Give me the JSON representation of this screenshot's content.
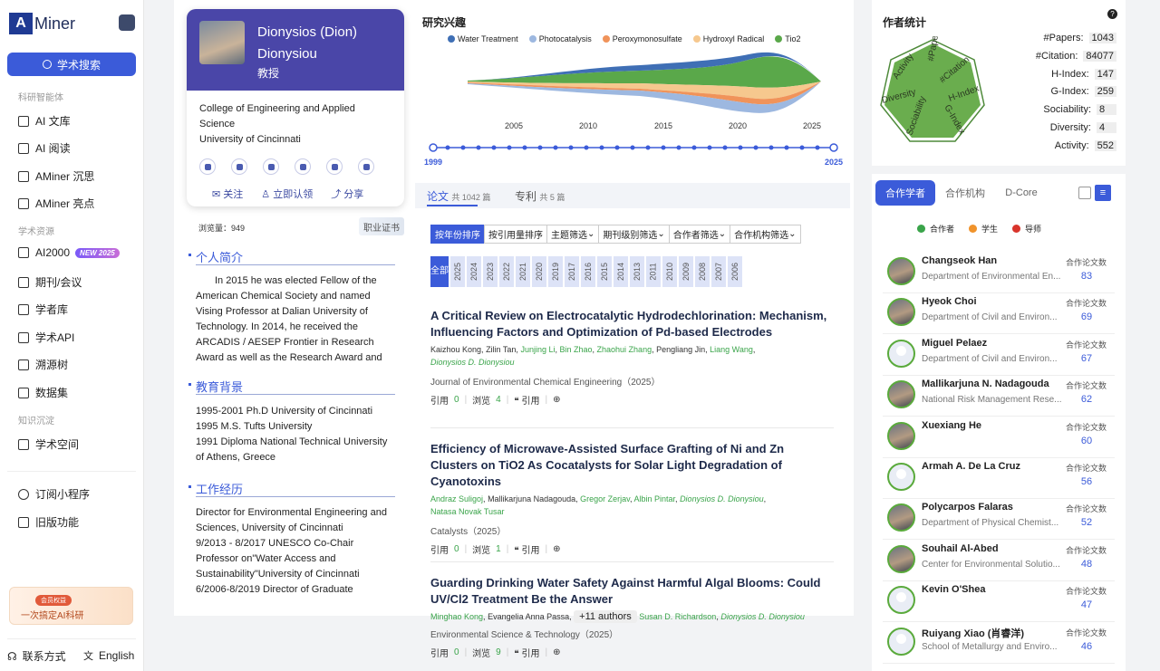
{
  "sidebar": {
    "logo_mark": "A",
    "logo_text": "Miner",
    "search_label": "学术搜索",
    "section1": "科研智能体",
    "items1": [
      "AI 文库",
      "AI 阅读",
      "AMiner 沉思",
      "AMiner 亮点"
    ],
    "section2": "学术资源",
    "items2": [
      "AI2000",
      "期刊/会议",
      "学者库",
      "学术API",
      "溯源树",
      "数据集"
    ],
    "new_badge": "NEW 2025",
    "section3": "知识沉淀",
    "items3": [
      "学术空间"
    ],
    "items4": [
      "订阅小程序",
      "旧版功能"
    ],
    "promo_tag": "会员权益",
    "promo_text": "一次搞定AI科研",
    "contact": "联系方式",
    "language": "English"
  },
  "profile": {
    "name_line1": "Dionysios (Dion)",
    "name_line2": "Dionysiou",
    "title": "教授",
    "affiliation": "College of Engineering and Applied Science",
    "university": "University of Cincinnati",
    "follow": "关注",
    "claim": "立即认领",
    "share": "分享",
    "views": "浏览量：949",
    "cert": "职业证书",
    "bio_heading": "个人简介",
    "bio": "In 2015 he was elected Fellow of the American Chemical Society and named Vising Professor at Dalian University of Technology. In 2014, he received the ARCADIS / AESEP Frontier in Research Award as well as the Research Award and",
    "edu_heading": "教育背景",
    "edu": [
      "1995-2001 Ph.D University of Cincinnati",
      "1995 M.S. Tufts University",
      "1991 Diploma National Technical University of Athens, Greece"
    ],
    "work_heading": "工作经历",
    "work": [
      "Director for Environmental Engineering and Sciences, University of Cincinnati",
      "9/2013 - 8/2017 UNESCO Co-Chair Professor on\"Water Access and Sustainability\"University of Cincinnati",
      "6/2006-8/2019 Director of Graduate"
    ]
  },
  "interests": {
    "heading": "研究兴趣",
    "topics": [
      {
        "name": "Water Treatment",
        "color": "#3f6fb5"
      },
      {
        "name": "Photocatalysis",
        "color": "#9db8e0"
      },
      {
        "name": "Peroxymonosulfate",
        "color": "#f0935a"
      },
      {
        "name": "Hydroxyl Radical",
        "color": "#f6c88e"
      },
      {
        "name": "Tio2",
        "color": "#5aa84a"
      }
    ],
    "axis_years": [
      "2005",
      "2010",
      "2015",
      "2020",
      "2025"
    ],
    "range_start": "1999",
    "range_end": "2025"
  },
  "papers_tabs": {
    "papers_label": "论文",
    "papers_count": "共 1042 篇",
    "patents_label": "专利",
    "patents_count": "共 5 篇"
  },
  "filters": [
    "按年份排序",
    "按引用量排序",
    "主题筛选",
    "期刊级别筛选",
    "合作者筛选",
    "合作机构筛选"
  ],
  "years": {
    "all": "全部",
    "list": [
      "2025",
      "2024",
      "2023",
      "2022",
      "2021",
      "2020",
      "2019",
      "2017",
      "2016",
      "2015",
      "2014",
      "2013",
      "2011",
      "2010",
      "2009",
      "2008",
      "2007",
      "2006"
    ]
  },
  "papers": [
    {
      "title": "A Critical Review on Electrocatalytic Hydrodechlorination: Mechanism, Influencing Factors and Optimization of Pd-based Electrodes",
      "venue": "Journal of Environmental Chemical Engineering（2025）",
      "cite_label": "引用",
      "cite": "0",
      "view_label": "浏览",
      "views": "4",
      "quote": "引用"
    },
    {
      "title": "Efficiency of Microwave-Assisted Surface Grafting of Ni and Zn Clusters on TiO2 As Cocatalysts for Solar Light Degradation of Cyanotoxins",
      "venue": "Catalysts（2025）",
      "cite_label": "引用",
      "cite": "0",
      "view_label": "浏览",
      "views": "1",
      "quote": "引用"
    },
    {
      "title": "Guarding Drinking Water Safety Against Harmful Algal Blooms: Could UV/Cl2 Treatment Be the Answer",
      "venue": "Environmental Science & Technology（2025）",
      "cite_label": "引用",
      "cite": "0",
      "view_label": "浏览",
      "views": "9",
      "quote": "引用",
      "more": "+11 authors"
    }
  ],
  "paper_authors": [
    [
      "Kaizhou Kong",
      "Zilin Tan",
      "Junjing Li",
      "Bin Zhao",
      "Zhaohui Zhang",
      "Pengliang Jin",
      "Liang Wang",
      "Dionysios D. Dionysiou"
    ],
    [
      "Andraz Suligoj",
      "Mallikarjuna Nadagouda",
      "Gregor Zerjav",
      "Albin Pintar",
      "Dionysios D. Dionysiou",
      "Natasa Novak Tusar"
    ],
    [
      "Minghao Kong",
      "Evangelia Anna Passa",
      "Susan D. Richardson",
      "Dionysios D. Dionysiou"
    ]
  ],
  "stats": {
    "heading": "作者统计",
    "help": "?",
    "radar_labels": [
      "#Papers",
      "#Citation",
      "H-Index",
      "G-Index",
      "Sociability",
      "Diversity",
      "Activity"
    ],
    "rows": [
      {
        "label": "#Papers:",
        "value": "1043"
      },
      {
        "label": "#Citation:",
        "value": "84077"
      },
      {
        "label": "H-Index:",
        "value": "147"
      },
      {
        "label": "G-Index:",
        "value": "259"
      },
      {
        "label": "Sociability:",
        "value": "8"
      },
      {
        "label": "Diversity:",
        "value": "4"
      },
      {
        "label": "Activity:",
        "value": "552"
      }
    ]
  },
  "coauthors": {
    "tabs": [
      "合作学者",
      "合作机构",
      "D-Core"
    ],
    "legend": [
      {
        "label": "合作者",
        "color": "#3aa44a"
      },
      {
        "label": "学生",
        "color": "#f0932b"
      },
      {
        "label": "导师",
        "color": "#d9342b"
      }
    ],
    "count_label": "合作论文数",
    "list": [
      {
        "name": "Changseok Han",
        "org": "Department of Environmental En...",
        "count": "83"
      },
      {
        "name": "Hyeok Choi",
        "org": "Department of Civil and Environ...",
        "count": "69"
      },
      {
        "name": "Miguel Pelaez",
        "org": "Department of Civil and Environ...",
        "count": "67"
      },
      {
        "name": "Mallikarjuna N. Nadagouda",
        "org": "National Risk Management Rese...",
        "count": "62"
      },
      {
        "name": "Xuexiang He",
        "org": "",
        "count": "60"
      },
      {
        "name": "Armah A. De La Cruz",
        "org": "",
        "count": "56"
      },
      {
        "name": "Polycarpos Falaras",
        "org": "Department of Physical Chemist...",
        "count": "52"
      },
      {
        "name": "Souhail Al-Abed",
        "org": "Center for Environmental Solutio...",
        "count": "48"
      },
      {
        "name": "Kevin O'Shea",
        "org": "",
        "count": "47"
      },
      {
        "name": "Ruiyang Xiao (肖睿洋)",
        "org": "School of Metallurgy and Enviro...",
        "count": "46"
      }
    ]
  }
}
